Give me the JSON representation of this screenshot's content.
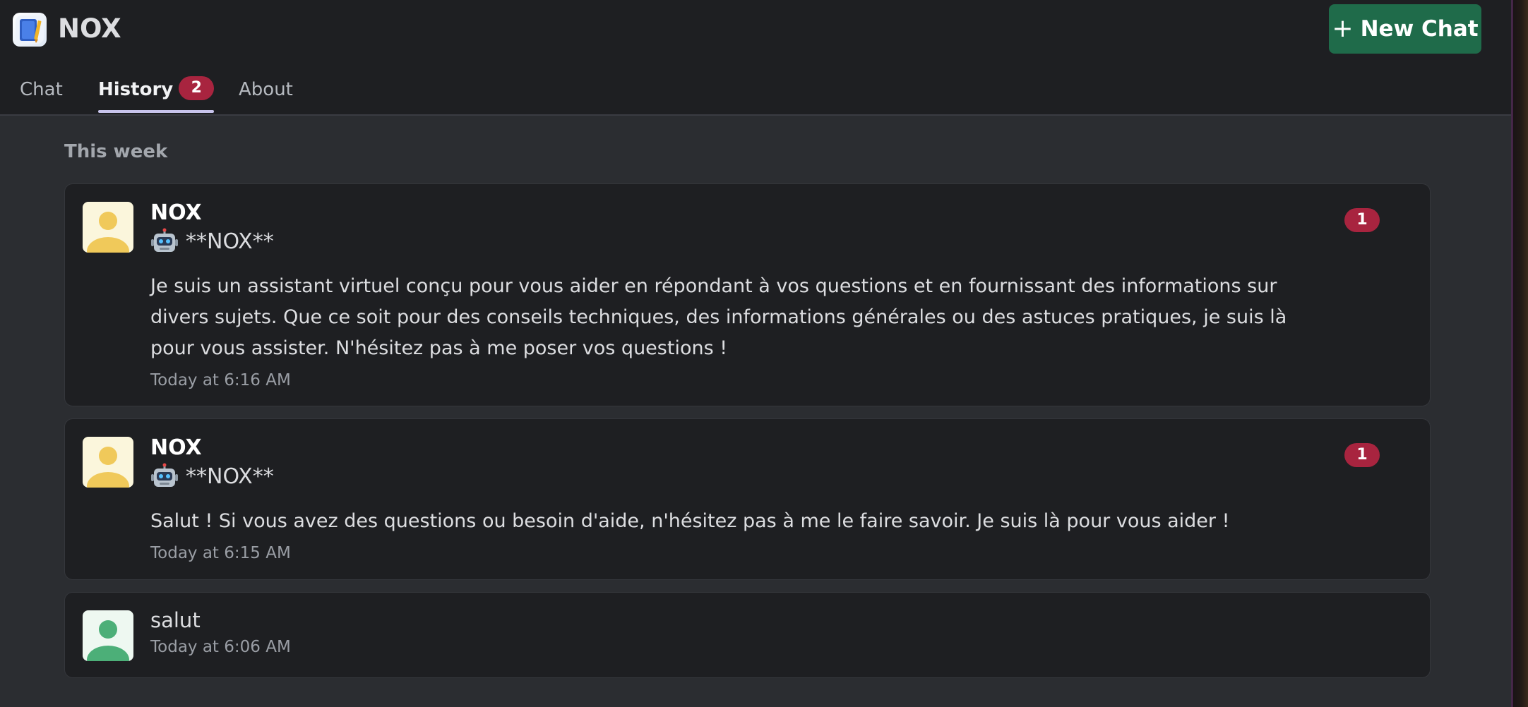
{
  "app": {
    "title": "NOX",
    "new_chat_label": "New Chat",
    "accent_color": "#1f6b4a",
    "badge_color": "#a8243f"
  },
  "tabs": [
    {
      "label": "Chat",
      "active": false
    },
    {
      "label": "History",
      "active": true,
      "badge": "2"
    },
    {
      "label": "About",
      "active": false
    }
  ],
  "history": {
    "section_title": "This week",
    "items": [
      {
        "sender": "NOX",
        "subtitle": "**NOX**",
        "subtitle_icon": "robot-icon",
        "text": "Je suis un assistant virtuel conçu pour vous aider en répondant à vos questions et en fournissant des informations sur divers sujets. Que ce soit pour des conseils techniques, des informations générales ou des astuces pratiques, je suis là pour vous assister. N'hésitez pas à me poser vos questions !",
        "time": "Today at 6:16 AM",
        "unread": "1",
        "avatar_color": "#f0c95a"
      },
      {
        "sender": "NOX",
        "subtitle": "**NOX**",
        "subtitle_icon": "robot-icon",
        "text": "Salut ! Si vous avez des questions ou besoin d'aide, n'hésitez pas à me le faire savoir. Je suis là pour vous aider !",
        "time": "Today at 6:15 AM",
        "unread": "1",
        "avatar_color": "#f0c95a"
      },
      {
        "text": "salut",
        "time": "Today at 6:06 AM",
        "avatar_color": "#4caf78"
      }
    ]
  }
}
